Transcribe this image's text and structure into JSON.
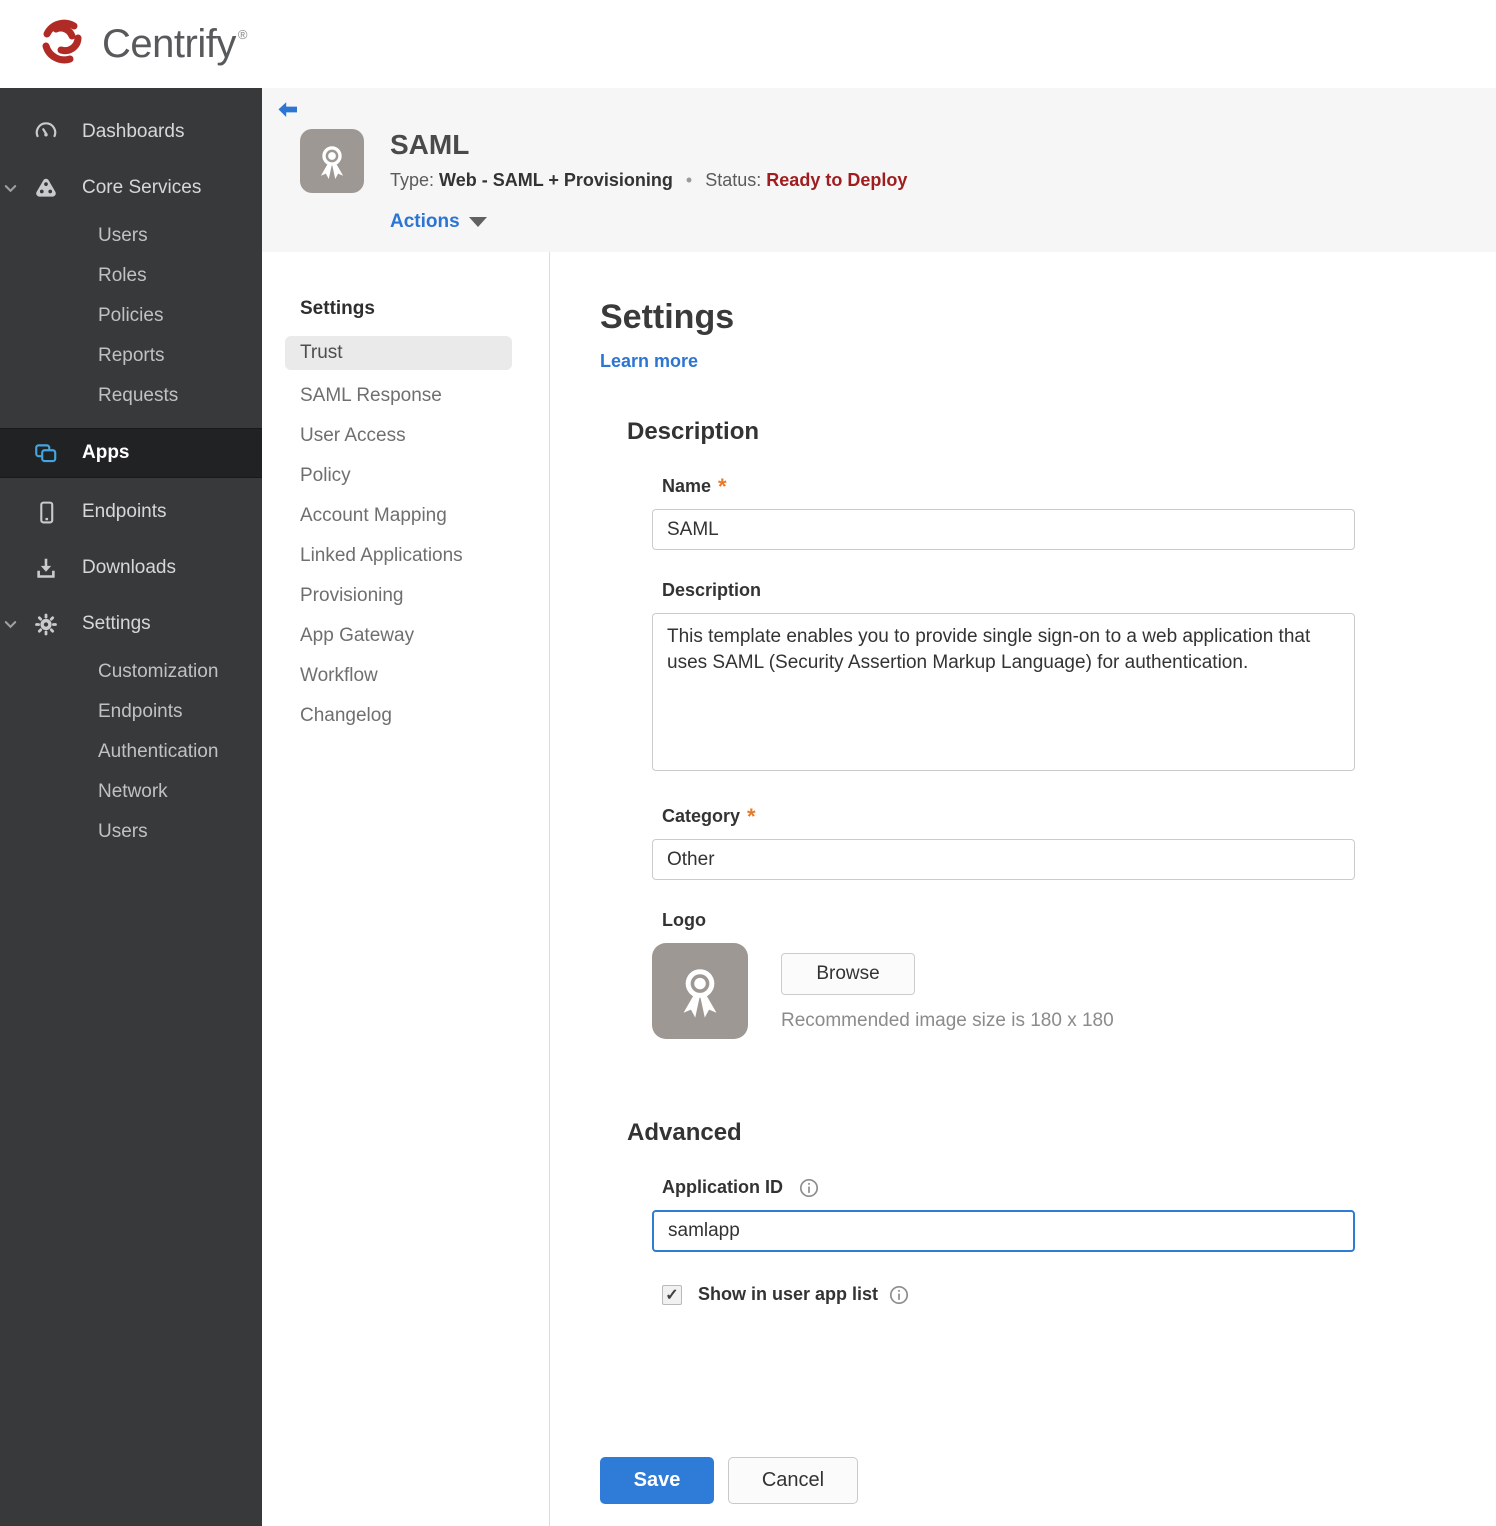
{
  "brand": {
    "name": "Centrify",
    "mark": "®"
  },
  "sidebar": {
    "items": [
      {
        "label": "Dashboards"
      },
      {
        "label": "Core Services"
      },
      {
        "label": "Users"
      },
      {
        "label": "Roles"
      },
      {
        "label": "Policies"
      },
      {
        "label": "Reports"
      },
      {
        "label": "Requests"
      },
      {
        "label": "Apps"
      },
      {
        "label": "Endpoints"
      },
      {
        "label": "Downloads"
      },
      {
        "label": "Settings"
      },
      {
        "label": "Customization"
      },
      {
        "label": "Endpoints"
      },
      {
        "label": "Authentication"
      },
      {
        "label": "Network"
      },
      {
        "label": "Users"
      }
    ]
  },
  "app_header": {
    "title": "SAML",
    "type_label": "Type:",
    "type_value": "Web - SAML + Provisioning",
    "separator": "•",
    "status_label": "Status:",
    "status_value": "Ready to Deploy",
    "actions_label": "Actions"
  },
  "subnav": {
    "heading": "Settings",
    "items": [
      "Trust",
      "SAML Response",
      "User Access",
      "Policy",
      "Account Mapping",
      "Linked Applications",
      "Provisioning",
      "App Gateway",
      "Workflow",
      "Changelog"
    ],
    "active_item": "Trust"
  },
  "form": {
    "title": "Settings",
    "learn_more": "Learn more",
    "description_section": "Description",
    "name_label": "Name",
    "name_value": "SAML",
    "description_label": "Description",
    "description_value": "This template enables you to provide single sign-on to a web application that uses SAML (Security Assertion Markup Language) for authentication.",
    "category_label": "Category",
    "category_value": "Other",
    "logo_label": "Logo",
    "browse_label": "Browse",
    "logo_hint": "Recommended image size is 180 x 180",
    "advanced_section": "Advanced",
    "application_id_label": "Application ID",
    "application_id_value": "samlapp",
    "show_in_app_list_label": "Show in user app list",
    "save_label": "Save",
    "cancel_label": "Cancel"
  },
  "icons": {
    "check": "✓"
  },
  "colors": {
    "accent_blue": "#2c75d2",
    "button_blue": "#2f7cd8",
    "status_red": "#9f1d1f",
    "asterisk_orange": "#e87a28",
    "sidebar_bg": "#38393b",
    "sidebar_active_bg": "#202224",
    "apps_icon_blue": "#45a3e0"
  }
}
